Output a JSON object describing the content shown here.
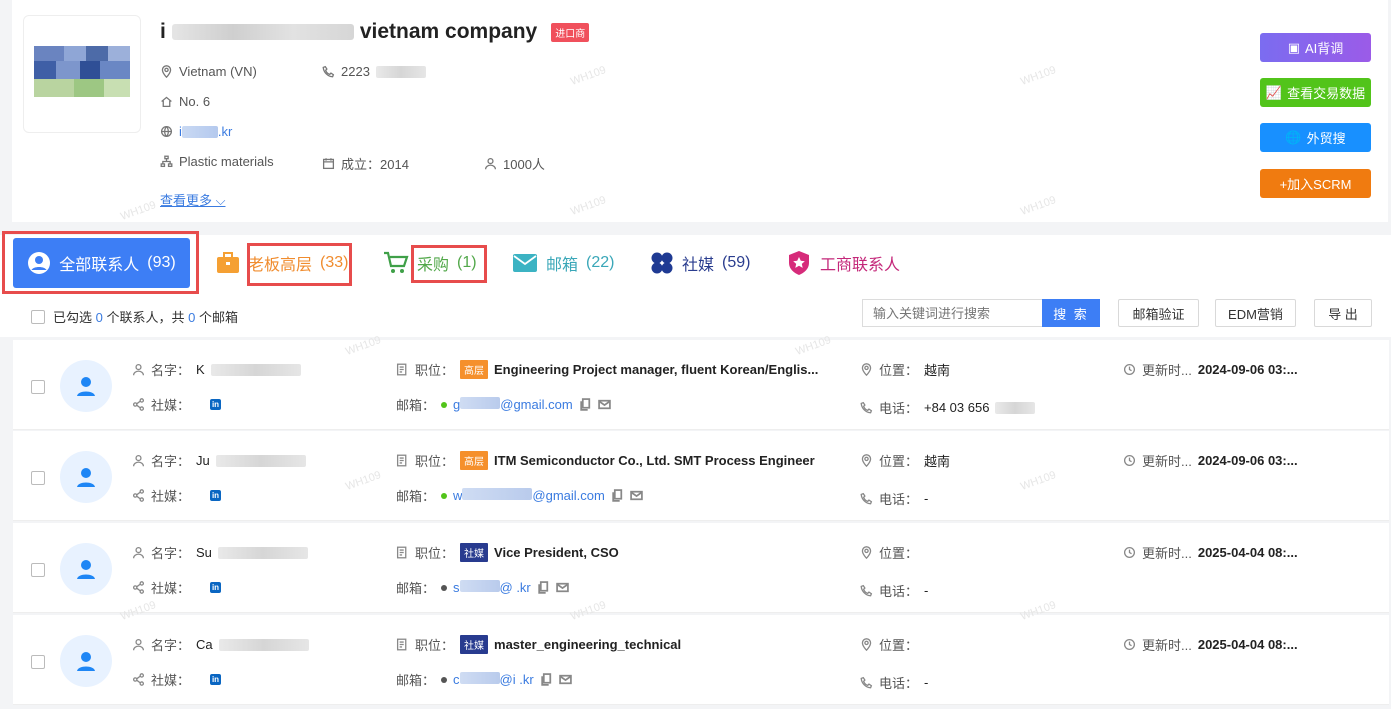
{
  "company": {
    "name_prefix": "i",
    "name_suffix": "vietnam company",
    "tag": "进口商",
    "country": "Vietnam (VN)",
    "phone": "2223",
    "address": "No. 6",
    "website": "i",
    "website_tld": ".kr",
    "industry": "Plastic materials",
    "founded": "成立：2014",
    "employees": "1000人",
    "more_label": "查看更多"
  },
  "actions": {
    "ai": "AI背调",
    "trade": "查看交易数据",
    "search": "外贸搜",
    "scrm": "+加入SCRM"
  },
  "tabs": [
    {
      "label": "全部联系人",
      "count": "(93)"
    },
    {
      "label": "老板高层",
      "count": "(33)"
    },
    {
      "label": "采购",
      "count": "(1)"
    },
    {
      "label": "邮箱",
      "count": "(22)"
    },
    {
      "label": "社媒",
      "count": "(59)"
    },
    {
      "label": "工商联系人",
      "count": ""
    }
  ],
  "selection": {
    "pre": "已勾选",
    "contacts": "0",
    "mid": "个联系人，共",
    "emails": "0",
    "post": "个邮箱"
  },
  "toolbar": {
    "search_placeholder": "输入关键词进行搜索",
    "search_btn": "搜 索",
    "verify": "邮箱验证",
    "edm": "EDM营销",
    "export": "导 出"
  },
  "labels": {
    "name": "名字：",
    "social": "社媒：",
    "position": "职位：",
    "email": "邮箱：",
    "location": "位置：",
    "phone": "电话：",
    "updated": "更新时..."
  },
  "contacts": [
    {
      "name": "K",
      "badge": "高层",
      "position": "Engineering Project manager, fluent Korean/Englis...",
      "email_pre": "g",
      "email_post": "@gmail.com",
      "location": "越南",
      "phone": "+84 03 656",
      "updated": "2024-09-06 03:..."
    },
    {
      "name": "Ju",
      "badge": "高层",
      "position": "ITM Semiconductor Co., Ltd. SMT Process Engineer",
      "email_pre": "w",
      "email_post": "@gmail.com",
      "location": "越南",
      "phone": "-",
      "updated": "2024-09-06 03:..."
    },
    {
      "name": "Su",
      "badge": "社媒",
      "position": "Vice President, CSO",
      "email_pre": "s",
      "email_post": "@          .kr",
      "location": "",
      "phone": "-",
      "updated": "2025-04-04 08:..."
    },
    {
      "name": "Ca",
      "badge": "社媒",
      "position": "master_engineering_technical",
      "email_pre": "c",
      "email_post": "@i          .kr",
      "location": "",
      "phone": "-",
      "updated": "2025-04-04 08:..."
    }
  ],
  "watermark": "WH109"
}
